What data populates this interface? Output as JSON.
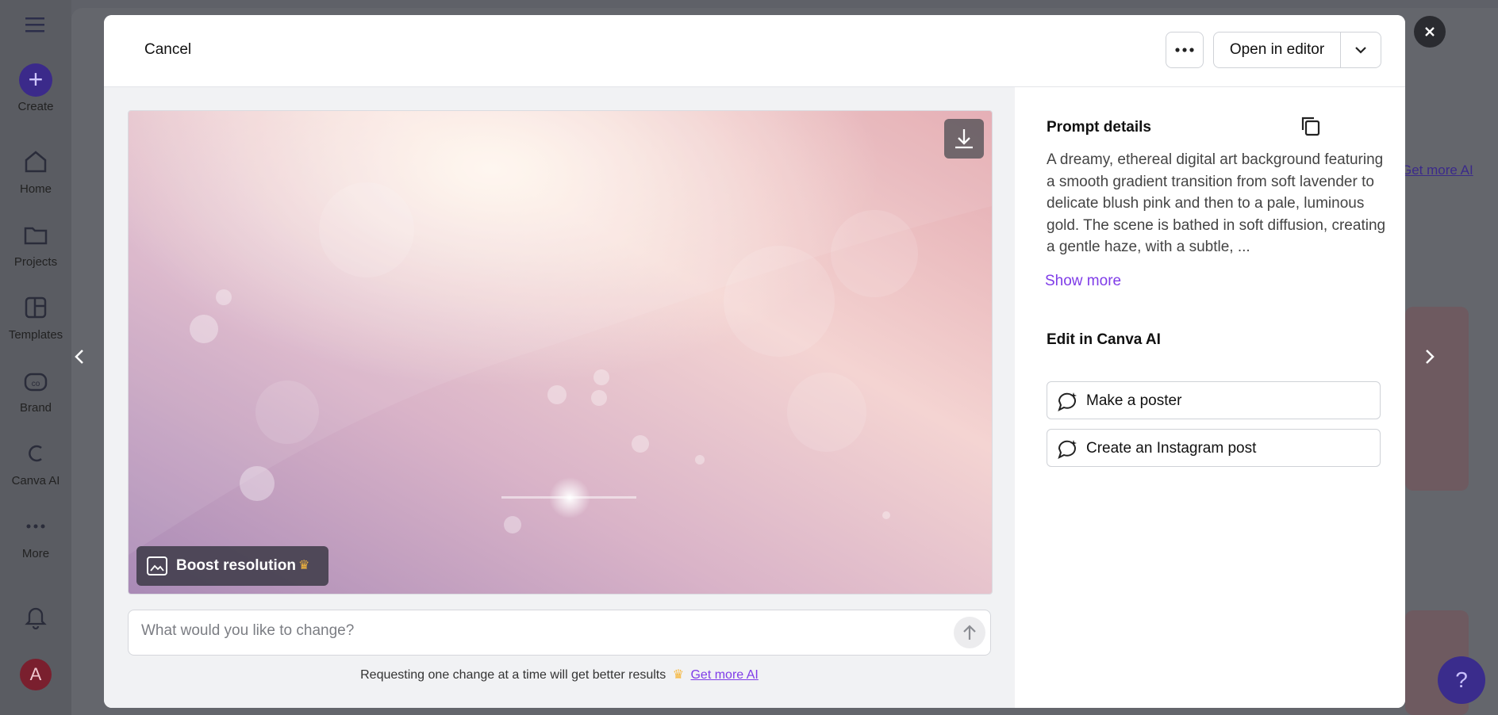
{
  "sidebar": {
    "menu_icon": "hamburger-icon",
    "items": [
      {
        "label": "Create",
        "icon": "plus-icon"
      },
      {
        "label": "Home",
        "icon": "home-icon"
      },
      {
        "label": "Projects",
        "icon": "folder-icon"
      },
      {
        "label": "Templates",
        "icon": "templates-icon"
      },
      {
        "label": "Brand",
        "icon": "brand-icon"
      },
      {
        "label": "Canva AI",
        "icon": "canva-ai-icon"
      },
      {
        "label": "More",
        "icon": "more-dots-icon"
      }
    ],
    "avatar_letter": "A"
  },
  "background": {
    "get_more_ai": "Get more AI",
    "help": "?"
  },
  "modal": {
    "cancel_label": "Cancel",
    "more_label": "•••",
    "open_in_editor_label": "Open in editor",
    "boost_label": "Boost resolution",
    "change_placeholder": "What would you like to change?",
    "hint_text": "Requesting one change at a time will get better results",
    "hint_link": "Get more AI",
    "prompt_details_title": "Prompt details",
    "prompt_text": "A dreamy, ethereal digital art background featuring a smooth gradient transition from soft lavender to delicate blush pink and then to a pale, luminous gold. The scene is bathed in soft diffusion, creating a gentle haze, with a subtle, ...",
    "show_more_label": "Show more",
    "edit_title": "Edit in Canva AI",
    "actions": [
      {
        "label": "Make a poster"
      },
      {
        "label": "Create an Instagram post"
      }
    ]
  },
  "colors": {
    "accent": "#7f3ce8",
    "crown": "#f6b73c",
    "brand_purple": "#3b2a8a"
  }
}
